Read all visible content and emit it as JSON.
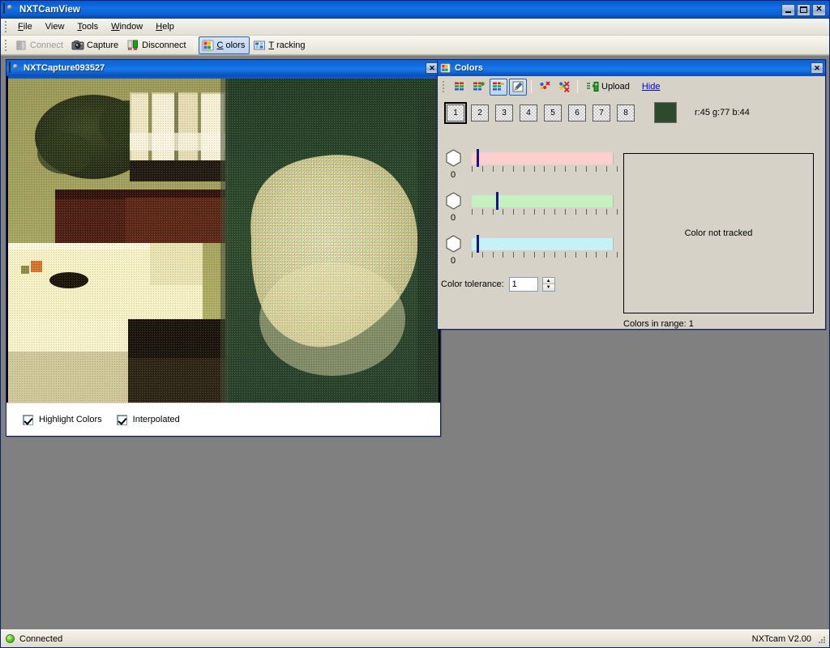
{
  "window": {
    "title": "NXTCamView",
    "icon": "camera-icon",
    "buttons": {
      "minimize": "_",
      "maximize": "□",
      "close": "✕"
    }
  },
  "menu": {
    "items": [
      {
        "label": "File",
        "accel": "F"
      },
      {
        "label": "View",
        "accel": ""
      },
      {
        "label": "Tools",
        "accel": "T"
      },
      {
        "label": "Window",
        "accel": "W"
      },
      {
        "label": "Help",
        "accel": "H"
      }
    ]
  },
  "toolbar": {
    "items": [
      {
        "label": "Connect",
        "icon": "plug-connect-icon",
        "state": "disabled"
      },
      {
        "label": "Capture",
        "icon": "camera-icon",
        "state": "enabled"
      },
      {
        "label": "Disconnect",
        "icon": "plug-disconnect-icon",
        "state": "enabled"
      },
      {
        "label": "Colors",
        "icon": "colors-palette-icon",
        "state": "active"
      },
      {
        "label": "Tracking",
        "icon": "tracking-grid-icon",
        "state": "enabled"
      }
    ]
  },
  "capture_window": {
    "title": "NXTCapture093527",
    "icon": "camera-icon",
    "close_label": "✕",
    "options": [
      {
        "label": "Highlight Colors",
        "checked": true
      },
      {
        "label": "Interpolated",
        "checked": true
      }
    ]
  },
  "colors_panel": {
    "title": "Colors",
    "icon": "colors-palette-icon",
    "close_label": "✕",
    "toolbar": [
      {
        "name": "add-color-map",
        "icon": "color-map-icon",
        "selected": false
      },
      {
        "name": "add-color",
        "icon": "color-map-plus-icon",
        "selected": false
      },
      {
        "name": "remove-color",
        "icon": "color-map-minus-icon",
        "selected": true
      },
      {
        "name": "edit-color",
        "icon": "pencil-edit-icon",
        "selected": true
      },
      {
        "name": "clear-selection",
        "icon": "palette-delete-icon",
        "selected": false
      },
      {
        "name": "clear-all",
        "icon": "palette-delete-all-icon",
        "selected": false
      }
    ],
    "upload_label": "Upload",
    "upload_icon": "upload-to-device-icon",
    "hide_label": "Hide",
    "color_slots": [
      "1",
      "2",
      "3",
      "4",
      "5",
      "6",
      "7",
      "8"
    ],
    "selected_slot": "1",
    "swatch_hex": "#2d4a2c",
    "rgb_text": "r:45 g:77 b:44",
    "sliders": [
      {
        "channel": "red",
        "zero_label": "0",
        "track_color": "#fccfce",
        "value_pct": 3,
        "ticks": 15
      },
      {
        "channel": "green",
        "zero_label": "0",
        "track_color": "#c5f0c0",
        "value_pct": 31,
        "ticks": 15
      },
      {
        "channel": "blue",
        "zero_label": "0",
        "track_color": "#c6f1f8",
        "value_pct": 3,
        "ticks": 15
      }
    ],
    "tolerance_label": "Color tolerance:",
    "tolerance_value": "1",
    "spin_up": "▲",
    "spin_down": "▼",
    "preview_text": "Color not tracked",
    "colors_in_range": "Colors in range: 1"
  },
  "status_bar": {
    "connection": "Connected",
    "version": "NXTcam V2.00",
    "led_color": "#5cc41e"
  }
}
